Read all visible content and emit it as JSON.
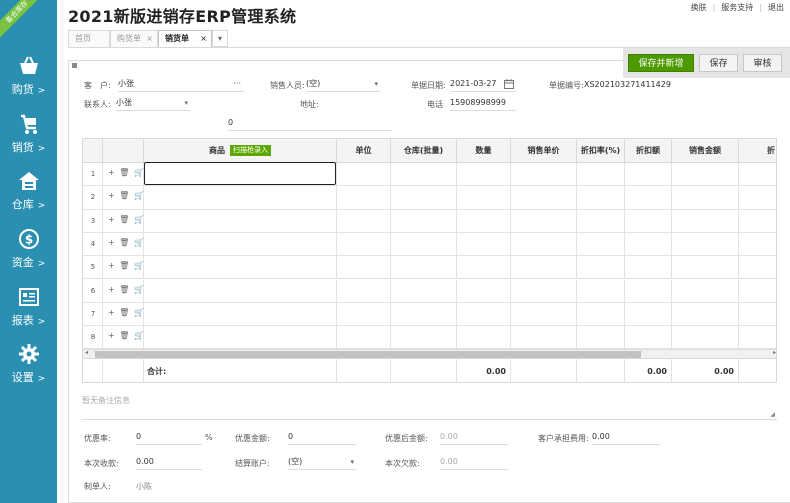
{
  "sidebar": {
    "badge": "备合库存",
    "items": [
      {
        "label": "购货",
        "icon": "basket-icon"
      },
      {
        "label": "销货",
        "icon": "cart-icon"
      },
      {
        "label": "仓库",
        "icon": "warehouse-icon"
      },
      {
        "label": "资金",
        "icon": "dollar-icon"
      },
      {
        "label": "报表",
        "icon": "report-icon"
      },
      {
        "label": "设置",
        "icon": "gear-icon"
      }
    ],
    "arrow": ">"
  },
  "header": {
    "title": "2021新版进销存ERP管理系统",
    "links": [
      "换肤",
      "服务支持",
      "退出"
    ]
  },
  "tabs": [
    {
      "label": "首页"
    },
    {
      "label": "购货单",
      "close": "×"
    },
    {
      "label": "销货单",
      "close": "×"
    }
  ],
  "tab_menu": "▾",
  "actions": {
    "save_new": "保存并新增",
    "save": "保存",
    "audit": "审核"
  },
  "form": {
    "customer_label": "客　户:",
    "customer_value": "小张",
    "customer_more": "···",
    "salesperson_label": "销售人员:",
    "salesperson_value": "(空)",
    "date_label": "单据日期:",
    "date_value": "2021-03-27",
    "docno_label": "单据编号:",
    "docno_value": "XS202103271411429",
    "contact_label": "联系人:",
    "contact_value": "小张",
    "address_label": "地址:",
    "address_value": "0",
    "phone_label": "电话",
    "phone_value": "15908998999"
  },
  "grid": {
    "columns": [
      "",
      "",
      "商品",
      "单位",
      "仓库(批量)",
      "数量",
      "销售单价",
      "折扣率(%)",
      "折扣额",
      "销售金额",
      "折"
    ],
    "scan_label": "扫描枪录入",
    "row_ops": "+ 🗑 🛒",
    "rows": [
      "1",
      "2",
      "3",
      "4",
      "5",
      "6",
      "7",
      "8"
    ],
    "total_label": "合计:",
    "total_qty": "0.00",
    "total_discount": "0.00",
    "total_amount": "0.00"
  },
  "remark_placeholder": "暂无备注信息",
  "footer": {
    "discount_rate_label": "优惠率:",
    "discount_rate_value": "0",
    "percent": "%",
    "discount_amount_label": "优惠金额:",
    "discount_amount_value": "0",
    "after_discount_label": "优惠后金额:",
    "after_discount_value": "0.00",
    "customer_fee_label": "客户承担费用:",
    "customer_fee_value": "0.00",
    "received_label": "本次收款:",
    "received_value": "0.00",
    "account_label": "结算账户:",
    "account_value": "(空)",
    "owed_label": "本次欠款:",
    "owed_value": "0.00",
    "maker_label": "制单人:",
    "maker_value": "小陈"
  },
  "colors": {
    "sidebar": "#2a8fb0",
    "primary": "#4d9a00",
    "badge": "#7cc242"
  }
}
